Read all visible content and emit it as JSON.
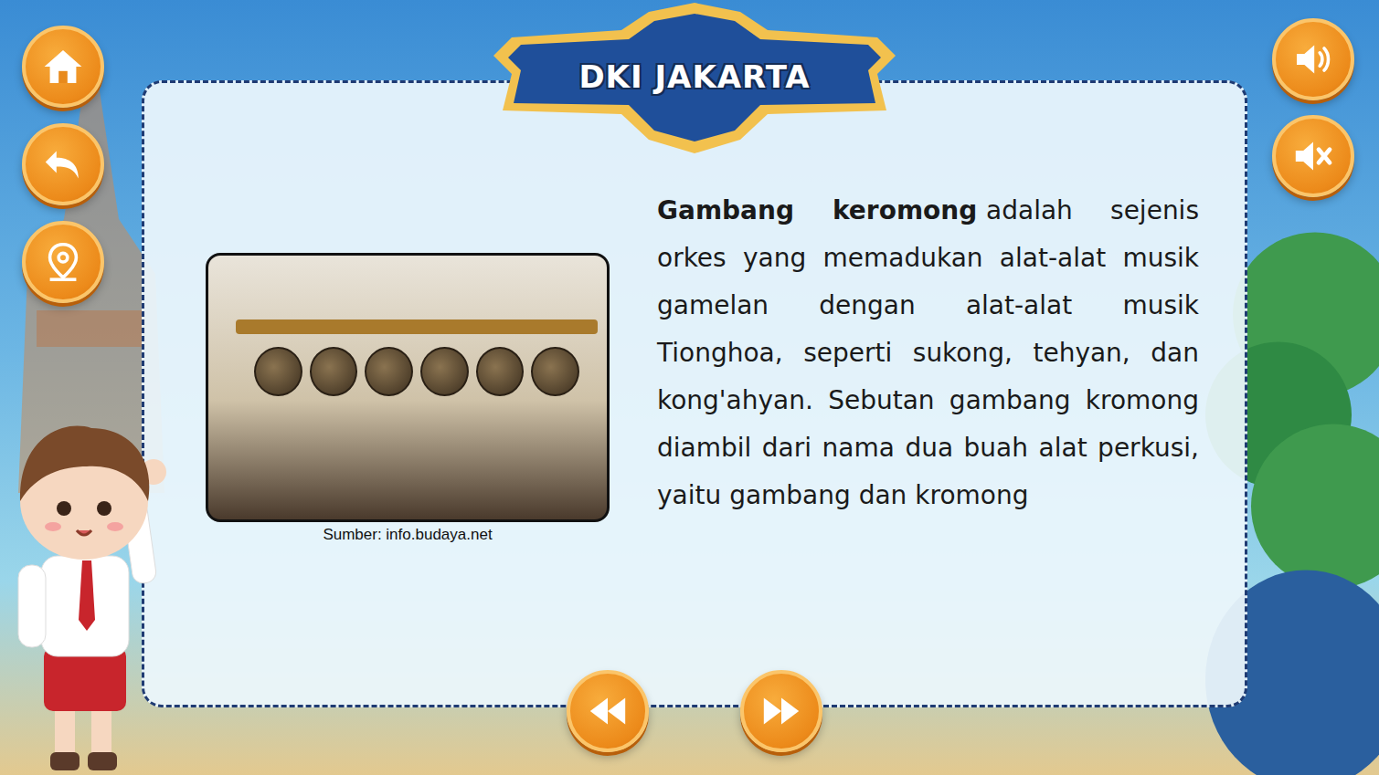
{
  "header": {
    "title": "DKI JAKARTA"
  },
  "article": {
    "term": "Gambang keromong",
    "body": "adalah sejenis orkes yang memadukan alat-alat musik gamelan dengan alat-alat musik Tionghoa, seperti sukong, tehyan, dan kong'ahyan. Sebutan gambang kromong diambil dari nama dua buah alat perkusi, yaitu gambang dan kromong"
  },
  "photo": {
    "caption": "Sumber: info.budaya.net"
  }
}
